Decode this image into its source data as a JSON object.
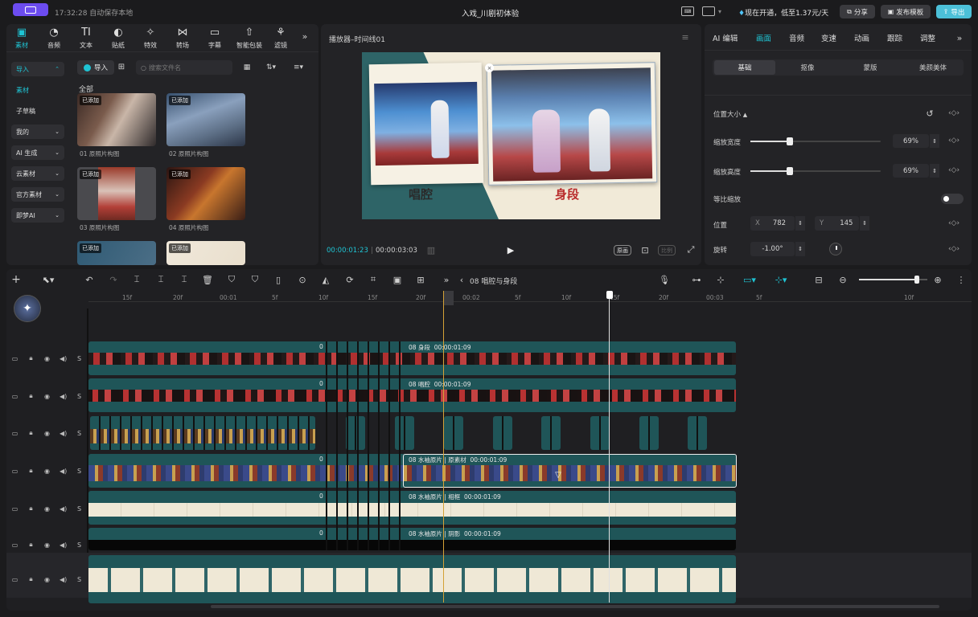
{
  "titlebar": {
    "time_status": "17:32:28 自动保存本地",
    "project_title": "入戏_川剧初体验",
    "promo": "现在开通，低至1.37元/天",
    "share_label": "分享",
    "publish_label": "发布模板",
    "export_label": "导出"
  },
  "media_toolbar": {
    "items": [
      "素材",
      "音频",
      "文本",
      "贴纸",
      "特效",
      "转场",
      "字幕",
      "智能包装",
      "滤镜"
    ]
  },
  "media_sidebar": {
    "items": [
      "导入",
      "素材",
      "子草稿",
      "我的",
      "AI 生成",
      "云素材",
      "官方素材",
      "即梦AI"
    ]
  },
  "media_panel": {
    "import_label": "导入",
    "search_placeholder": "搜索文件名",
    "section_label": "全部",
    "added_badge": "已添加",
    "thumbnails": [
      {
        "caption": "01 原照片构图"
      },
      {
        "caption": "02 原照片构图"
      },
      {
        "caption": "03 原照片构图"
      },
      {
        "caption": "04 原照片构图"
      }
    ]
  },
  "player": {
    "title": "播放器–时间线01",
    "current_time": "00:00:01:23",
    "total_time": "00:00:03:03",
    "caption_left": "唱腔",
    "caption_right": "身段",
    "ratio_label": "原画",
    "ratio_label2": "比例"
  },
  "inspector": {
    "tabs": [
      "AI 编辑",
      "画面",
      "音频",
      "变速",
      "动画",
      "跟踪",
      "调整"
    ],
    "active_tab": "画面",
    "subtabs": [
      "基础",
      "抠像",
      "蒙版",
      "美颜美体"
    ],
    "section": "位置大小",
    "scale_width_label": "缩放宽度",
    "scale_width_value": "69%",
    "scale_width_fraction": 0.3,
    "scale_height_label": "缩放高度",
    "scale_height_value": "69%",
    "scale_height_fraction": 0.3,
    "uniform_label": "等比缩放",
    "position_label": "位置",
    "pos_x_label": "X",
    "pos_x": "782",
    "pos_y_label": "Y",
    "pos_y": "145",
    "rotation_label": "旋转",
    "rotation_value": "-1.00°"
  },
  "timeline_toolbar": {
    "breadcrumb": "08 唱腔与身段",
    "zoom_fraction": 0.85
  },
  "ruler": {
    "ticks": [
      "15f",
      "20f",
      "00:01",
      "5f",
      "10f",
      "15f",
      "20f",
      "00:02",
      "5f",
      "10f",
      "15f",
      "20f",
      "00:03",
      "5f",
      "10f"
    ]
  },
  "tracks": {
    "short_label": "0",
    "clip1": "08 身段",
    "clip1_time": "00:00:01:09",
    "clip2": "08 唱腔",
    "clip2_time": "00:00:01:09",
    "clip4": "08 水袖原片",
    "clip4_sub": "原素材",
    "clip4_time": "00:00:01:09",
    "clip5": "08 水袖原片",
    "clip5_sub": "相框",
    "clip5_time": "00:00:01:09",
    "clip6": "08 水袖原片",
    "clip6_sub": "阴影",
    "clip6_time": "00:00:01:09",
    "ctrl_s": "S"
  },
  "colors": {
    "accent": "#1fc4d4",
    "teal_track": "#1f5558",
    "playhead": "#e0e0e0",
    "marker": "#d4a136",
    "export_bg": "#4cc0d8"
  }
}
